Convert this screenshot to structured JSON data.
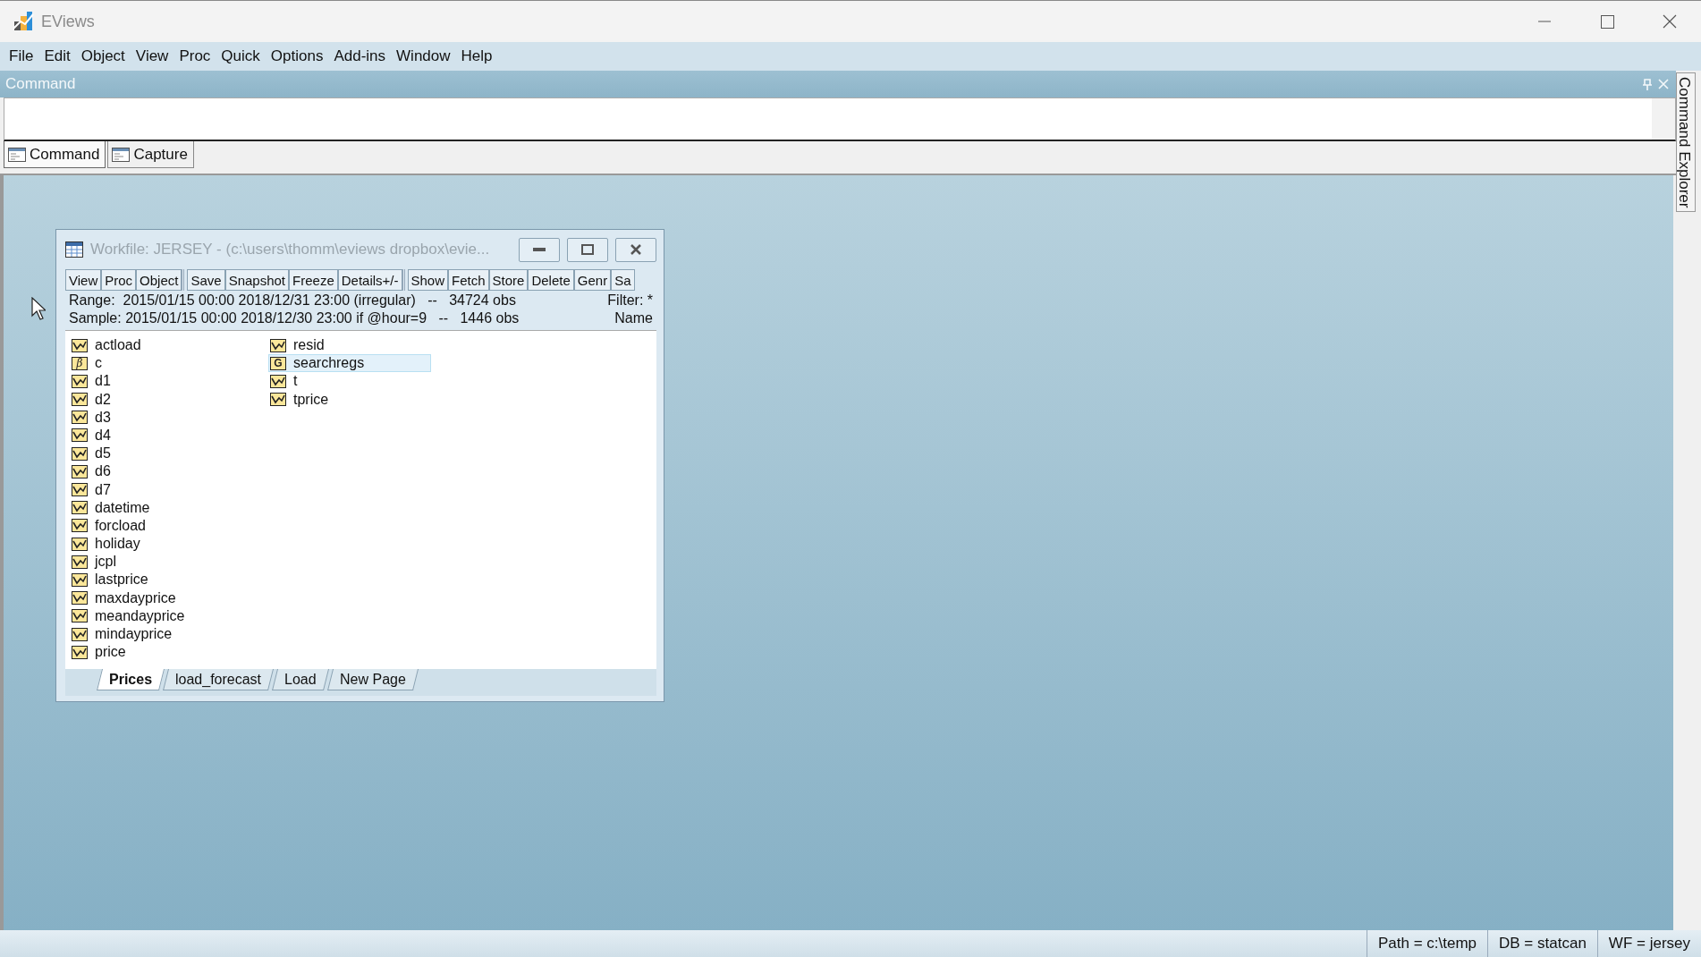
{
  "window": {
    "title": "EViews"
  },
  "menu": [
    "File",
    "Edit",
    "Object",
    "View",
    "Proc",
    "Quick",
    "Options",
    "Add-ins",
    "Window",
    "Help"
  ],
  "command_pane": {
    "title": "Command",
    "tabs": [
      {
        "label": "Command",
        "selected": true
      },
      {
        "label": "Capture",
        "selected": false
      }
    ]
  },
  "side_tab": {
    "label": "Command Explorer"
  },
  "workfile": {
    "title": "Workfile: JERSEY - (c:\\users\\thomm\\eviews dropbox\\evie...",
    "toolbar": [
      [
        "View",
        "Proc",
        "Object"
      ],
      [
        "Save",
        "Snapshot",
        "Freeze",
        "Details+/-"
      ],
      [
        "Show",
        "Fetch",
        "Store",
        "Delete",
        "Genr",
        "Sa"
      ]
    ],
    "range": "Range:  2015/01/15 00:00 2018/12/31 23:00 (irregular)   --   34724 obs",
    "filter": "Filter: *",
    "sample": "Sample: 2015/01/15 00:00 2018/12/30 23:00 if @hour=9   --   1446 obs",
    "sort": "Name",
    "objects": [
      {
        "name": "actload",
        "kind": "series",
        "selected": false
      },
      {
        "name": "c",
        "kind": "coef",
        "icon_text": "β",
        "selected": false
      },
      {
        "name": "d1",
        "kind": "series",
        "selected": false
      },
      {
        "name": "d2",
        "kind": "series",
        "selected": false
      },
      {
        "name": "d3",
        "kind": "series",
        "selected": false
      },
      {
        "name": "d4",
        "kind": "series",
        "selected": false
      },
      {
        "name": "d5",
        "kind": "series",
        "selected": false
      },
      {
        "name": "d6",
        "kind": "series",
        "selected": false
      },
      {
        "name": "d7",
        "kind": "series",
        "selected": false
      },
      {
        "name": "datetime",
        "kind": "series",
        "selected": false
      },
      {
        "name": "forcload",
        "kind": "series",
        "selected": false
      },
      {
        "name": "holiday",
        "kind": "series",
        "selected": false
      },
      {
        "name": "jcpl",
        "kind": "series",
        "selected": false
      },
      {
        "name": "lastprice",
        "kind": "series",
        "selected": false
      },
      {
        "name": "maxdayprice",
        "kind": "series",
        "selected": false
      },
      {
        "name": "meandayprice",
        "kind": "series",
        "selected": false
      },
      {
        "name": "mindayprice",
        "kind": "series",
        "selected": false
      },
      {
        "name": "price",
        "kind": "series",
        "selected": false
      },
      {
        "name": "resid",
        "kind": "series",
        "selected": false
      },
      {
        "name": "searchregs",
        "kind": "group",
        "icon_text": "G",
        "selected": true
      },
      {
        "name": "t",
        "kind": "series",
        "selected": false
      },
      {
        "name": "tprice",
        "kind": "series",
        "selected": false
      }
    ],
    "pages": [
      {
        "label": "Prices",
        "selected": true
      },
      {
        "label": "load_forecast",
        "selected": false
      },
      {
        "label": "Load",
        "selected": false
      },
      {
        "label": "New Page",
        "selected": false
      }
    ]
  },
  "status_bar": [
    "Path = c:\\temp",
    "DB = statcan",
    "WF = jersey"
  ]
}
